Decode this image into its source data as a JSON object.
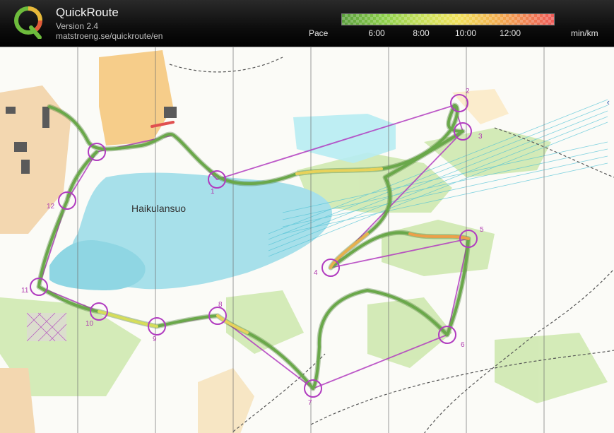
{
  "header": {
    "title": "QuickRoute",
    "version": "Version 2.4",
    "url": "matstroeng.se/quickroute/en",
    "pace_label": "Pace",
    "pace_ticks": [
      "6:00",
      "8:00",
      "10:00",
      "12:00"
    ],
    "pace_unit": "min/km"
  },
  "map": {
    "place_name": "Haikulansuo",
    "controls": [
      "1",
      "2",
      "3",
      "4",
      "5",
      "6",
      "7",
      "8",
      "9",
      "10",
      "11",
      "12"
    ],
    "colors": {
      "course": "#b13cc0",
      "water": "#9fdfe8",
      "open_land": "#f6d08f",
      "forest_green": "#c8e6a8",
      "route_fast": "#4c8a2e",
      "route_slow": "#e06040"
    },
    "scroll_icon": "chevron-left-icon"
  }
}
